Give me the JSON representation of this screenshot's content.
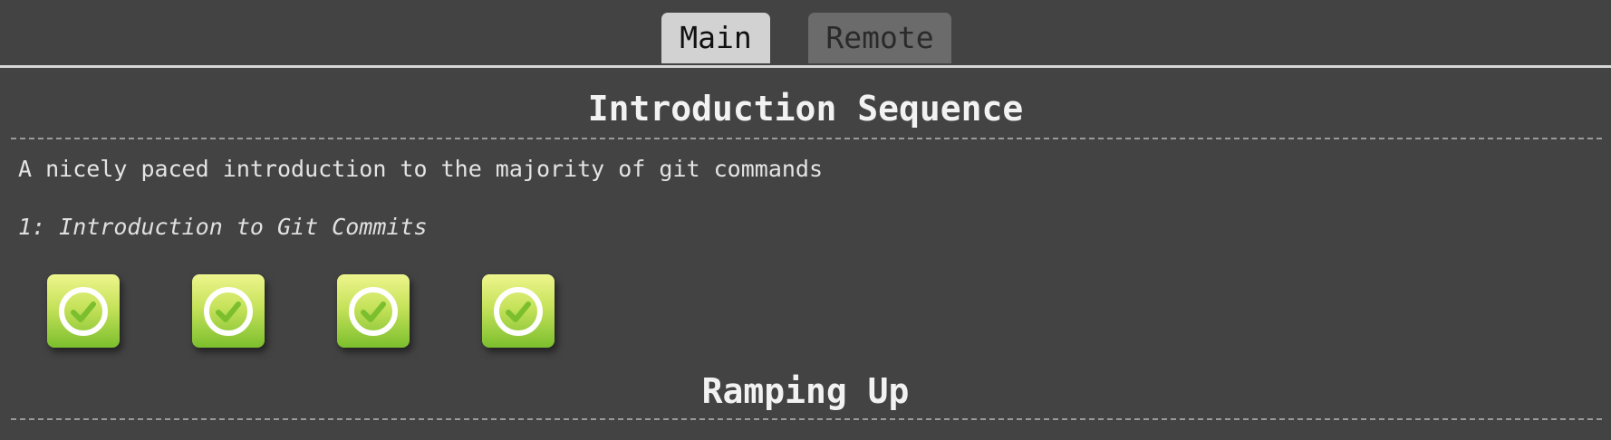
{
  "tabs": [
    {
      "label": "Main",
      "active": true
    },
    {
      "label": "Remote",
      "active": false
    }
  ],
  "sections": [
    {
      "title": "Introduction Sequence",
      "description": "A nicely paced introduction to the majority of git commands",
      "levels": [
        {
          "name": "1: Introduction to Git Commits",
          "buttons": [
            {
              "icon": "checkmark-circle-icon",
              "completed": true
            },
            {
              "icon": "checkmark-circle-icon",
              "completed": true
            },
            {
              "icon": "checkmark-circle-icon",
              "completed": true
            },
            {
              "icon": "checkmark-circle-icon",
              "completed": true
            }
          ]
        }
      ]
    },
    {
      "title": "Ramping Up"
    }
  ],
  "colors": {
    "background": "#434343",
    "active_tab": "#d2d2d2",
    "inactive_tab": "#6b6b6b",
    "complete_green": "#7cbf2e"
  }
}
